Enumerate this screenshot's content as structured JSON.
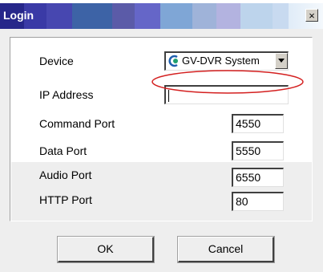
{
  "window": {
    "title": "Login"
  },
  "form": {
    "device": {
      "label": "Device",
      "selected": "GV-DVR System"
    },
    "ip_address": {
      "label": "IP Address",
      "value": ""
    },
    "command_port": {
      "label": "Command Port",
      "value": "4550"
    },
    "data_port": {
      "label": "Data Port",
      "value": "5550"
    },
    "audio_port": {
      "label": "Audio Port",
      "value": "6550"
    },
    "http_port": {
      "label": "HTTP Port",
      "value": "80"
    }
  },
  "buttons": {
    "ok": "OK",
    "cancel": "Cancel"
  },
  "icons": {
    "close": "close-icon",
    "device": "geovision-device-icon",
    "dropdown": "chevron-down-icon"
  },
  "colors": {
    "highlight_ellipse": "#d42020"
  }
}
